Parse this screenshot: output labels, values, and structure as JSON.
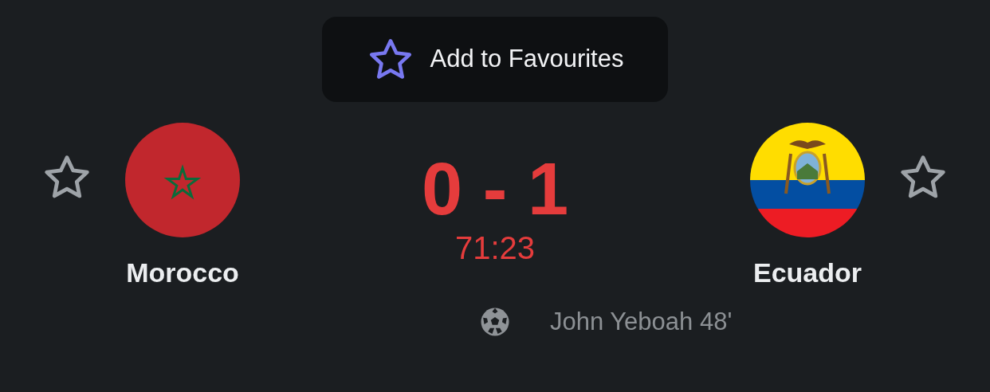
{
  "favourite_button": {
    "label": "Add to Favourites"
  },
  "home": {
    "name": "Morocco",
    "favourite": false,
    "kind": "morocco"
  },
  "away": {
    "name": "Ecuador",
    "favourite": false,
    "kind": "ecuador"
  },
  "score": "0 - 1",
  "clock": "71:23",
  "events": [
    {
      "kind": "goal",
      "text": "John Yeboah 48'"
    }
  ]
}
